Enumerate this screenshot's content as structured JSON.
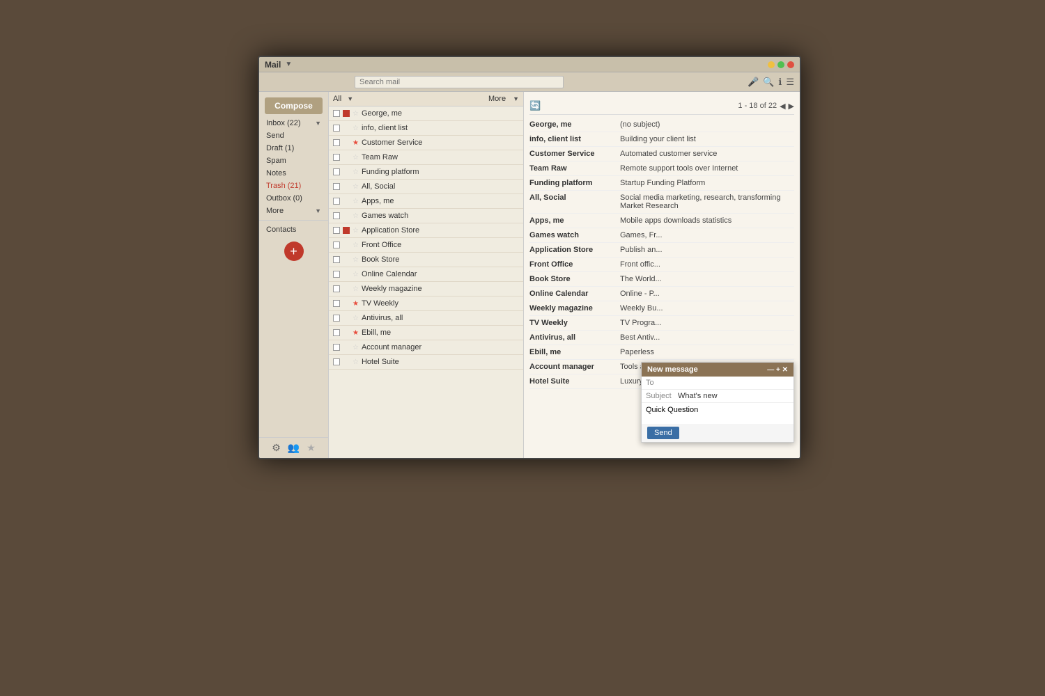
{
  "app": {
    "title": "Mail",
    "window_controls": [
      "close",
      "minimize",
      "expand"
    ]
  },
  "search": {
    "placeholder": "Search mail"
  },
  "toolbar": {
    "all_label": "All",
    "more_label": "More",
    "pagination": "1 - 18 of 22"
  },
  "sidebar": {
    "compose_label": "Compose",
    "items": [
      {
        "label": "Inbox (22)",
        "id": "inbox",
        "active": false,
        "count": 22
      },
      {
        "label": "Send",
        "id": "send",
        "active": false
      },
      {
        "label": "Draft (1)",
        "id": "draft",
        "active": false
      },
      {
        "label": "Spam",
        "id": "spam",
        "active": false
      },
      {
        "label": "Notes",
        "id": "notes",
        "active": false
      },
      {
        "label": "Trash (21)",
        "id": "trash",
        "active": true
      },
      {
        "label": "Outbox (0)",
        "id": "outbox",
        "active": false
      },
      {
        "label": "More",
        "id": "more",
        "active": false
      }
    ],
    "contacts_label": "Contacts",
    "fab_label": "+"
  },
  "email_list": {
    "rows": [
      {
        "sender": "George, me",
        "starred": false,
        "red_square": true,
        "subject": "(no subject)"
      },
      {
        "sender": "info, client list",
        "starred": false,
        "red_square": false,
        "subject": "Building your client list"
      },
      {
        "sender": "Customer Service",
        "starred": true,
        "red_square": false,
        "subject": "Automated customer service"
      },
      {
        "sender": "Team Raw",
        "starred": false,
        "red_square": false,
        "subject": "Remote support tools over Internet"
      },
      {
        "sender": "Funding platform",
        "starred": false,
        "red_square": false,
        "subject": "Startup Funding Platform"
      },
      {
        "sender": "All, Social",
        "starred": false,
        "red_square": false,
        "subject": "Social media marketing, research, transforming Market Research"
      },
      {
        "sender": "Apps, me",
        "starred": false,
        "red_square": false,
        "subject": "Mobile apps downloads statistics"
      },
      {
        "sender": "Games watch",
        "starred": false,
        "red_square": false,
        "subject": "Games, Fr..."
      },
      {
        "sender": "Application Store",
        "starred": false,
        "red_square": true,
        "subject": "Publish an..."
      },
      {
        "sender": "Front Office",
        "starred": false,
        "red_square": false,
        "subject": "Front offic..."
      },
      {
        "sender": "Book Store",
        "starred": false,
        "red_square": false,
        "subject": "The World..."
      },
      {
        "sender": "Online Calendar",
        "starred": false,
        "red_square": false,
        "subject": "Online - P..."
      },
      {
        "sender": "Weekly magazine",
        "starred": false,
        "red_square": false,
        "subject": "Weekly Bu..."
      },
      {
        "sender": "TV Weekly",
        "starred": true,
        "red_square": false,
        "subject": "TV Progra..."
      },
      {
        "sender": "Antivirus, all",
        "starred": false,
        "red_square": false,
        "subject": "Best Antiv..."
      },
      {
        "sender": "Ebill, me",
        "starred": true,
        "red_square": false,
        "subject": "Paperless"
      },
      {
        "sender": "Account manager",
        "starred": false,
        "red_square": false,
        "subject": "Tools and"
      },
      {
        "sender": "Hotel Suite",
        "starred": false,
        "red_square": false,
        "subject": "Luxury Ho..."
      }
    ]
  },
  "new_message": {
    "header": "New message",
    "to_label": "To",
    "subject_label": "Subject",
    "subject_value": "What's new",
    "body": "Quick Question",
    "send_label": "Send",
    "close_label": "—  +  ✕"
  }
}
